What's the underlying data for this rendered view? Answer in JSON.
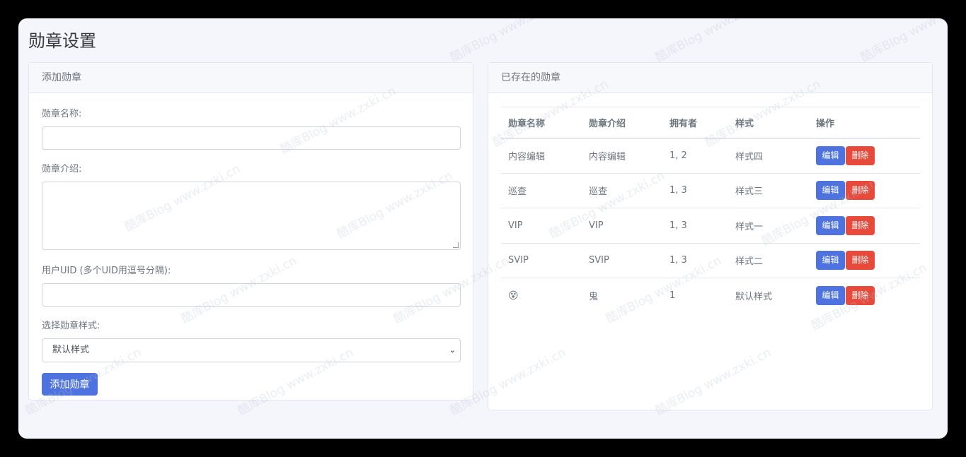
{
  "page": {
    "title": "勋章设置"
  },
  "add_form": {
    "header": "添加勋章",
    "name_label": "勋章名称:",
    "name_value": "",
    "intro_label": "勋章介绍:",
    "intro_value": "",
    "uid_label": "用户UID (多个UID用逗号分隔):",
    "uid_value": "",
    "style_label": "选择勋章样式:",
    "style_selected": "默认样式",
    "submit_label": "添加勋章"
  },
  "existing": {
    "header": "已存在的勋章",
    "columns": [
      "勋章名称",
      "勋章介绍",
      "拥有者",
      "样式",
      "操作"
    ],
    "rows": [
      {
        "name": "内容编辑",
        "intro": "内容编辑",
        "owners": "1, 2",
        "style": "样式四"
      },
      {
        "name": "巡查",
        "intro": "巡查",
        "owners": "1, 3",
        "style": "样式三"
      },
      {
        "name": "VIP",
        "intro": "VIP",
        "owners": "1, 3",
        "style": "样式一"
      },
      {
        "name": "SVIP",
        "intro": "SVIP",
        "owners": "1, 3",
        "style": "样式二"
      },
      {
        "name": "😵",
        "intro": "鬼",
        "owners": "1",
        "style": "默认样式"
      }
    ],
    "edit_label": "编辑",
    "delete_label": "删除"
  },
  "watermark": {
    "text": "酷库Blog www.zxki.cn"
  },
  "colors": {
    "primary": "#4e73df",
    "danger": "#e74a3b",
    "background": "#f5f6fb"
  }
}
